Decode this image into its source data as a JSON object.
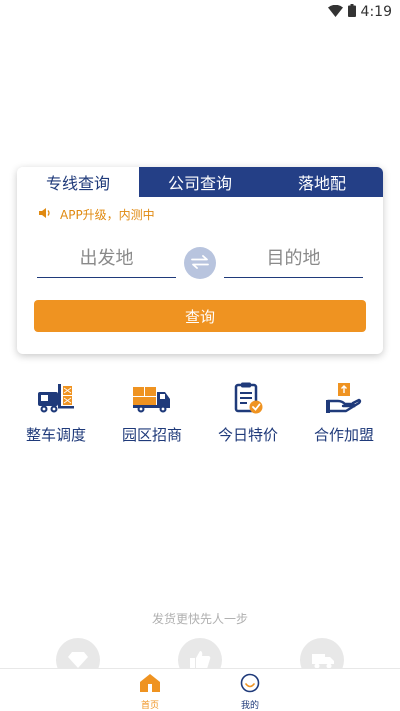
{
  "status_bar": {
    "time": "4:19"
  },
  "tabs": [
    {
      "label": "专线查询",
      "active": true
    },
    {
      "label": "公司查询",
      "active": false
    },
    {
      "label": "落地配",
      "active": false
    }
  ],
  "notice": {
    "text": "APP升级，内测中",
    "icon": "speaker-icon"
  },
  "search": {
    "from_placeholder": "出发地",
    "to_placeholder": "目的地",
    "query_label": "查询"
  },
  "shortcuts": [
    {
      "label": "整车调度",
      "icon": "forklift-truck-icon"
    },
    {
      "label": "园区招商",
      "icon": "cargo-truck-icon"
    },
    {
      "label": "今日特价",
      "icon": "clipboard-check-icon"
    },
    {
      "label": "合作加盟",
      "icon": "hand-package-icon"
    }
  ],
  "slogan": "发货更快先人一步",
  "bottom_nav": {
    "home_label": "首页",
    "mine_label": "我的"
  },
  "colors": {
    "brand_blue": "#243f86",
    "accent_orange": "#ef9321"
  }
}
